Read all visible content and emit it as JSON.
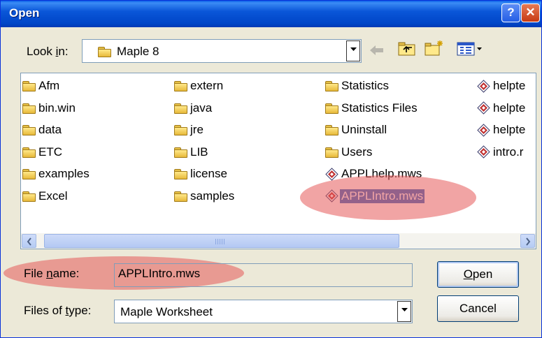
{
  "window": {
    "title": "Open",
    "help_glyph": "?",
    "close_glyph": "✕"
  },
  "lookin": {
    "label_pre": "Look ",
    "label_key": "i",
    "label_post": "n:",
    "value": "Maple 8"
  },
  "toolbar": {
    "icons": [
      "back-arrow-icon",
      "up-folder-icon",
      "new-folder-icon",
      "view-menu-icon"
    ]
  },
  "files": {
    "col1": [
      "Afm",
      "bin.win",
      "data",
      "ETC",
      "examples",
      "Excel"
    ],
    "col2": [
      "extern",
      "java",
      "jre",
      "LIB",
      "license",
      "samples"
    ],
    "col3_folders": [
      "Statistics",
      "Statistics Files",
      "Uninstall",
      "Users"
    ],
    "col3_files": [
      "APPLhelp.mws",
      "APPLIntro.mws"
    ],
    "col4_files": [
      "helpte",
      "helpte",
      "helpte",
      "intro.r"
    ],
    "selected": "APPLIntro.mws"
  },
  "filename": {
    "label_pre": "File ",
    "label_key": "n",
    "label_post": "ame:",
    "value": "APPLIntro.mws"
  },
  "filetype": {
    "label_pre": "Files of ",
    "label_key": "t",
    "label_post": "ype:",
    "value": "Maple Worksheet"
  },
  "buttons": {
    "open_key": "O",
    "open_rest": "pen",
    "cancel": "Cancel"
  },
  "colors": {
    "title_bar": "#0a56d8",
    "selection": "#316ac5",
    "highlight": "#e65a5a"
  }
}
